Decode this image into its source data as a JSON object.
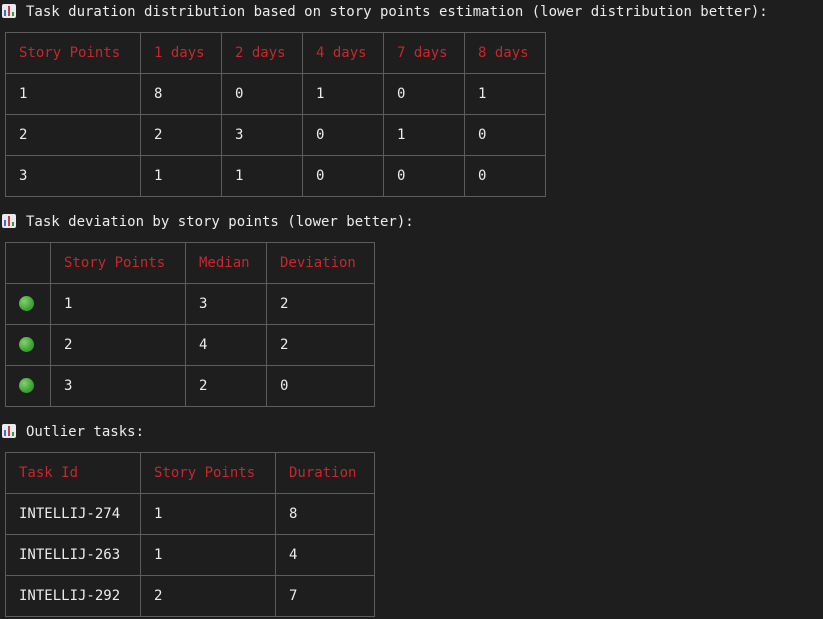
{
  "duration": {
    "title": "Task duration distribution based on story points estimation (lower distribution better):",
    "headers": [
      "Story Points",
      "1 days",
      "2 days",
      "4 days",
      "7 days",
      "8 days"
    ],
    "rows": [
      [
        "1",
        "8",
        "0",
        "1",
        "0",
        "1"
      ],
      [
        "2",
        "2",
        "3",
        "0",
        "1",
        "0"
      ],
      [
        "3",
        "1",
        "1",
        "0",
        "0",
        "0"
      ]
    ]
  },
  "deviation": {
    "title": "Task deviation by story points (lower better):",
    "headers": [
      "",
      "Story Points",
      "Median",
      "Deviation"
    ],
    "rows": [
      {
        "status": "green-circle-icon",
        "cells": [
          "1",
          "3",
          "2"
        ]
      },
      {
        "status": "green-circle-icon",
        "cells": [
          "2",
          "4",
          "2"
        ]
      },
      {
        "status": "green-circle-icon",
        "cells": [
          "3",
          "2",
          "0"
        ]
      }
    ]
  },
  "outliers": {
    "title": "Outlier tasks:",
    "headers": [
      "Task Id",
      "Story Points",
      "Duration"
    ],
    "rows": [
      [
        "INTELLIJ-274",
        "1",
        "8"
      ],
      [
        "INTELLIJ-263",
        "1",
        "4"
      ],
      [
        "INTELLIJ-292",
        "2",
        "7"
      ]
    ]
  },
  "colors": {
    "background": "#1e1e1e",
    "header_text": "#c9262c",
    "body_text": "#ececec",
    "border": "#5c5c5c",
    "status_green": "#3fa235"
  }
}
